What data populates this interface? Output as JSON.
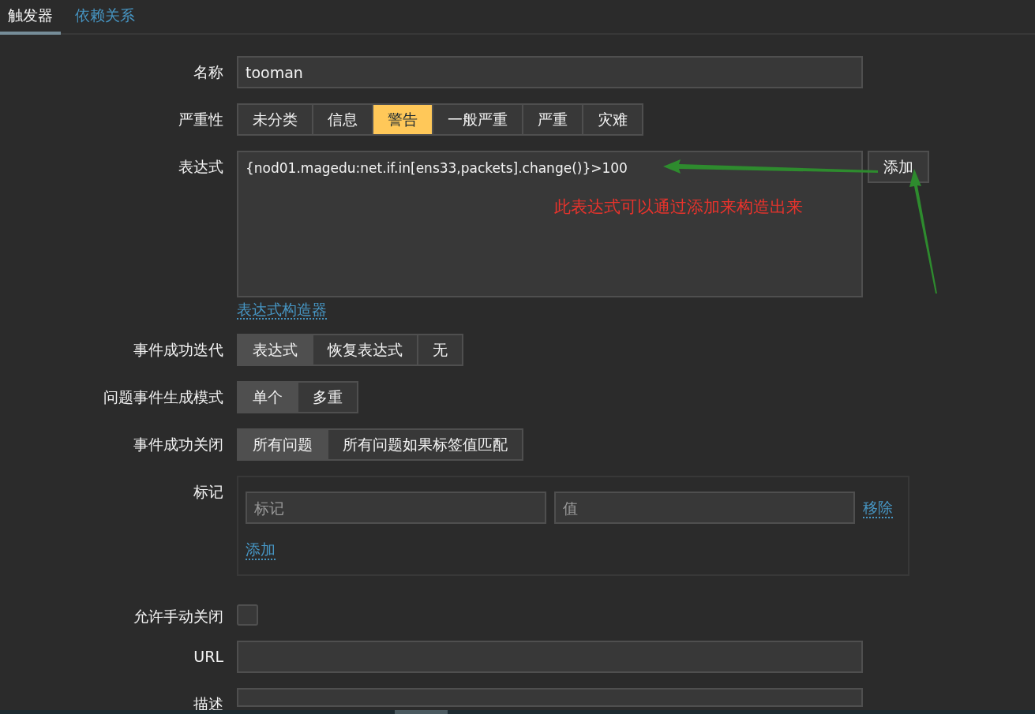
{
  "tabs": [
    {
      "label": "触发器",
      "selected": true
    },
    {
      "label": "依赖关系",
      "selected": false
    }
  ],
  "fields": [
    {
      "kind": "text",
      "label": "名称",
      "value": "tooman"
    },
    {
      "kind": "severity",
      "label": "严重性",
      "options": [
        {
          "label": "未分类",
          "selected": false
        },
        {
          "label": "信息",
          "selected": false
        },
        {
          "label": "警告",
          "selected": true
        },
        {
          "label": "一般严重",
          "selected": false
        },
        {
          "label": "严重",
          "selected": false
        },
        {
          "label": "灾难",
          "selected": false
        }
      ]
    },
    {
      "kind": "expression",
      "label": "表达式",
      "value": "{nod01.magedu:net.if.in[ens33,packets].change()}>100",
      "add_button": "添加",
      "builder_link": "表达式构造器",
      "note": "此表达式可以通过添加来构造出来"
    },
    {
      "kind": "segmented",
      "label": "事件成功迭代",
      "options": [
        {
          "label": "表达式",
          "selected": true
        },
        {
          "label": "恢复表达式",
          "selected": false
        },
        {
          "label": "无",
          "selected": false
        }
      ]
    },
    {
      "kind": "segmented",
      "label": "问题事件生成模式",
      "options": [
        {
          "label": "单个",
          "selected": true
        },
        {
          "label": "多重",
          "selected": false
        }
      ]
    },
    {
      "kind": "segmented",
      "label": "事件成功关闭",
      "options": [
        {
          "label": "所有问题",
          "selected": true
        },
        {
          "label": "所有问题如果标签值匹配",
          "selected": false
        }
      ]
    },
    {
      "kind": "tags",
      "label": "标记",
      "rows": [
        {
          "tag_placeholder": "标记",
          "value_placeholder": "值",
          "remove": "移除"
        }
      ],
      "add_link": "添加"
    },
    {
      "kind": "checkbox",
      "label": "允许手动关闭",
      "checked": false
    },
    {
      "kind": "text",
      "label": "URL"
    },
    {
      "kind": "text",
      "label": "描述"
    }
  ]
}
